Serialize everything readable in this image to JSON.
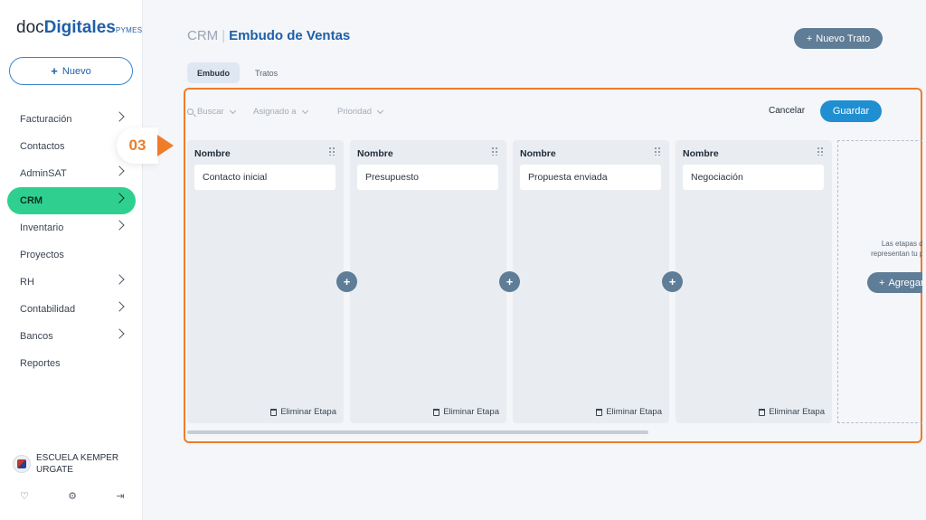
{
  "brand": {
    "logo_part1": "doc",
    "logo_part2": "Digitales",
    "logo_part3": "PYMES"
  },
  "sidebar": {
    "new_button": "Nuevo",
    "items": [
      {
        "label": "Facturación",
        "chevron": true
      },
      {
        "label": "Contactos",
        "chevron": false
      },
      {
        "label": "AdminSAT",
        "chevron": true
      },
      {
        "label": "CRM",
        "chevron": true,
        "active": true
      },
      {
        "label": "Inventario",
        "chevron": true
      },
      {
        "label": "Proyectos",
        "chevron": false
      },
      {
        "label": "RH",
        "chevron": true
      },
      {
        "label": "Contabilidad",
        "chevron": true
      },
      {
        "label": "Bancos",
        "chevron": true
      },
      {
        "label": "Reportes",
        "chevron": false
      }
    ],
    "user": {
      "name_line1": "ESCUELA KEMPER",
      "name_line2": "URGATE"
    },
    "footer_icons": [
      "bell-icon",
      "gear-icon",
      "logout-icon"
    ]
  },
  "header": {
    "breadcrumb_root": "CRM",
    "separator": "|",
    "title": "Embudo de Ventas",
    "new_deal_button": "Nuevo Trato"
  },
  "tabs": [
    {
      "label": "Embudo",
      "active": true
    },
    {
      "label": "Tratos",
      "active": false
    }
  ],
  "callout": {
    "step": "03",
    "color": "#ee7c2b"
  },
  "toolbar": {
    "search": "Buscar",
    "assigned": "Asignado a",
    "priority": "Prioridad",
    "cancel": "Cancelar",
    "save": "Guardar"
  },
  "stages": [
    {
      "header": "Nombre",
      "name": "Contacto inicial",
      "delete_label": "Eliminar Etapa"
    },
    {
      "header": "Nombre",
      "name": "Presupuesto",
      "delete_label": "Eliminar Etapa"
    },
    {
      "header": "Nombre",
      "name": "Propuesta enviada",
      "delete_label": "Eliminar Etapa"
    },
    {
      "header": "Nombre",
      "name": "Negociación",
      "delete_label": "Eliminar Etapa"
    }
  ],
  "add_stage": {
    "hint_line1": "Las etapas de",
    "hint_line2": "representan tu proce",
    "button": "Agregar"
  },
  "colors": {
    "accent_green": "#2fd08f",
    "brand_blue": "#1f5fa8",
    "save_blue": "#1f8fd1",
    "slate_button": "#5f7d96",
    "highlight_orange": "#ee7c2b"
  }
}
